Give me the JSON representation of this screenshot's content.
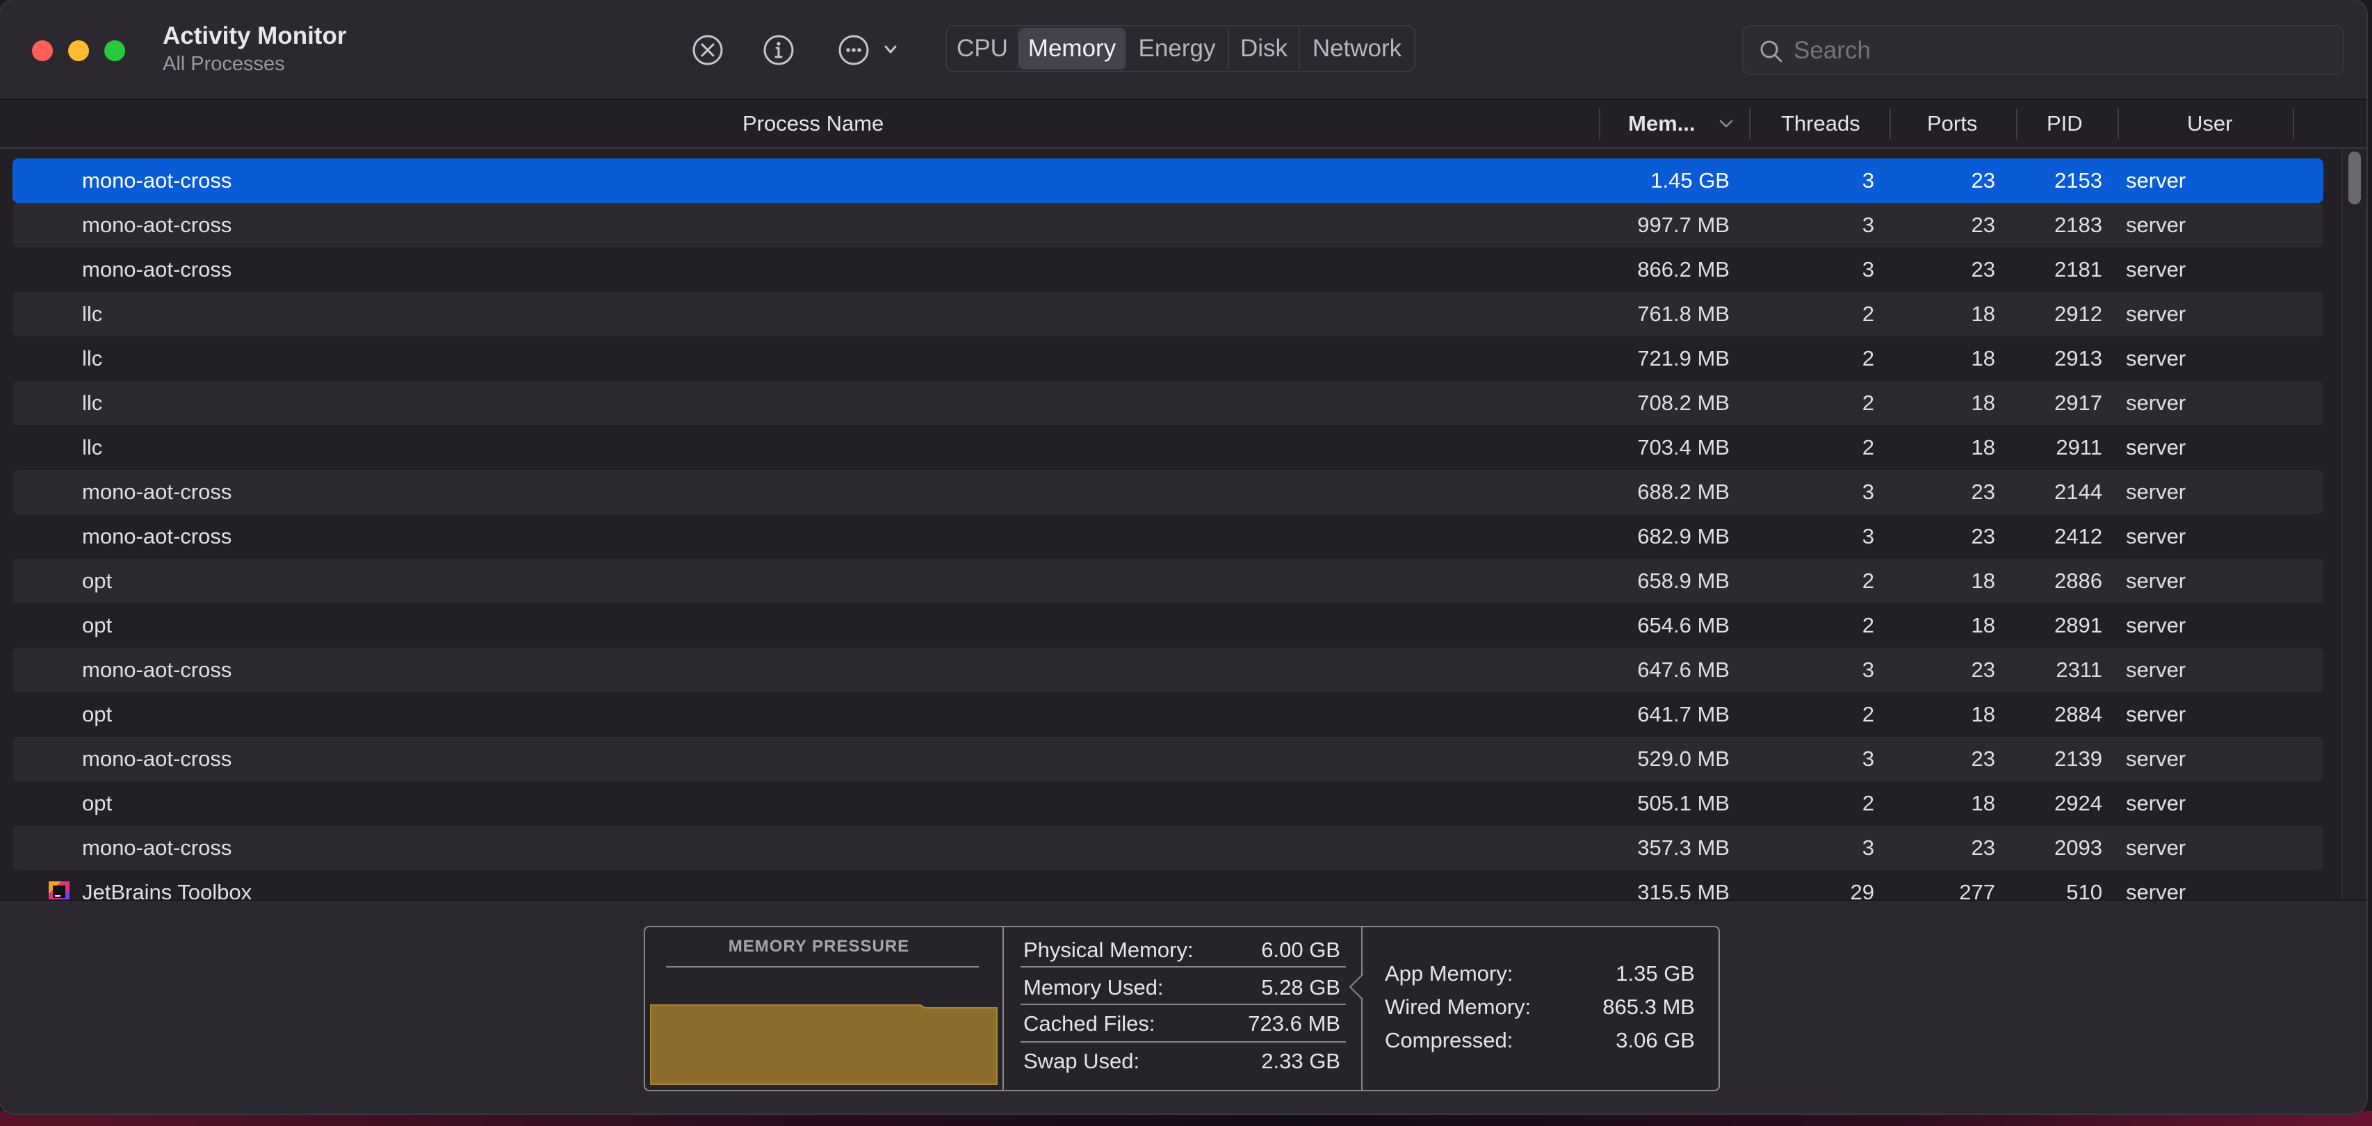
{
  "app": {
    "title": "Activity Monitor",
    "subtitle": "All Processes"
  },
  "toolbar": {
    "stop_icon": "x-circle-icon",
    "info_icon": "info-circle-icon",
    "more_icon": "ellipsis-circle-icon",
    "tabs": [
      {
        "label": "CPU",
        "active": false
      },
      {
        "label": "Memory",
        "active": true
      },
      {
        "label": "Energy",
        "active": false
      },
      {
        "label": "Disk",
        "active": false
      },
      {
        "label": "Network",
        "active": false
      }
    ]
  },
  "search": {
    "placeholder": "Search",
    "value": ""
  },
  "table": {
    "columns": {
      "name": "Process Name",
      "memory": "Mem...",
      "threads": "Threads",
      "ports": "Ports",
      "pid": "PID",
      "user": "User"
    },
    "sort_column": "memory",
    "sort_direction": "descending",
    "rows": [
      {
        "name": "mono-aot-cross",
        "memory": "1.45 GB",
        "threads": "3",
        "ports": "23",
        "pid": "2153",
        "user": "server",
        "selected": true
      },
      {
        "name": "mono-aot-cross",
        "memory": "997.7 MB",
        "threads": "3",
        "ports": "23",
        "pid": "2183",
        "user": "server"
      },
      {
        "name": "mono-aot-cross",
        "memory": "866.2 MB",
        "threads": "3",
        "ports": "23",
        "pid": "2181",
        "user": "server"
      },
      {
        "name": "llc",
        "memory": "761.8 MB",
        "threads": "2",
        "ports": "18",
        "pid": "2912",
        "user": "server"
      },
      {
        "name": "llc",
        "memory": "721.9 MB",
        "threads": "2",
        "ports": "18",
        "pid": "2913",
        "user": "server"
      },
      {
        "name": "llc",
        "memory": "708.2 MB",
        "threads": "2",
        "ports": "18",
        "pid": "2917",
        "user": "server"
      },
      {
        "name": "llc",
        "memory": "703.4 MB",
        "threads": "2",
        "ports": "18",
        "pid": "2911",
        "user": "server"
      },
      {
        "name": "mono-aot-cross",
        "memory": "688.2 MB",
        "threads": "3",
        "ports": "23",
        "pid": "2144",
        "user": "server"
      },
      {
        "name": "mono-aot-cross",
        "memory": "682.9 MB",
        "threads": "3",
        "ports": "23",
        "pid": "2412",
        "user": "server"
      },
      {
        "name": "opt",
        "memory": "658.9 MB",
        "threads": "2",
        "ports": "18",
        "pid": "2886",
        "user": "server"
      },
      {
        "name": "opt",
        "memory": "654.6 MB",
        "threads": "2",
        "ports": "18",
        "pid": "2891",
        "user": "server"
      },
      {
        "name": "mono-aot-cross",
        "memory": "647.6 MB",
        "threads": "3",
        "ports": "23",
        "pid": "2311",
        "user": "server"
      },
      {
        "name": "opt",
        "memory": "641.7 MB",
        "threads": "2",
        "ports": "18",
        "pid": "2884",
        "user": "server"
      },
      {
        "name": "mono-aot-cross",
        "memory": "529.0 MB",
        "threads": "3",
        "ports": "23",
        "pid": "2139",
        "user": "server"
      },
      {
        "name": "opt",
        "memory": "505.1 MB",
        "threads": "2",
        "ports": "18",
        "pid": "2924",
        "user": "server"
      },
      {
        "name": "mono-aot-cross",
        "memory": "357.3 MB",
        "threads": "3",
        "ports": "23",
        "pid": "2093",
        "user": "server"
      },
      {
        "name": "JetBrains Toolbox",
        "memory": "315.5 MB",
        "threads": "29",
        "ports": "277",
        "pid": "510",
        "user": "server",
        "icon": "jetbrains-toolbox-icon"
      }
    ]
  },
  "memory_panel": {
    "pressure_title": "MEMORY PRESSURE",
    "pressure_color": "#8b6e2e",
    "stats_left": [
      {
        "label": "Physical Memory:",
        "value": "6.00 GB"
      },
      {
        "label": "Memory Used:",
        "value": "5.28 GB"
      },
      {
        "label": "Cached Files:",
        "value": "723.6 MB"
      },
      {
        "label": "Swap Used:",
        "value": "2.33 GB"
      }
    ],
    "stats_right": [
      {
        "label": "App Memory:",
        "value": "1.35 GB"
      },
      {
        "label": "Wired Memory:",
        "value": "865.3 MB"
      },
      {
        "label": "Compressed:",
        "value": "3.06 GB"
      }
    ]
  },
  "colors": {
    "selection": "#0a5bd6",
    "window_bg": "#2b2830",
    "table_bg": "#221f25"
  }
}
